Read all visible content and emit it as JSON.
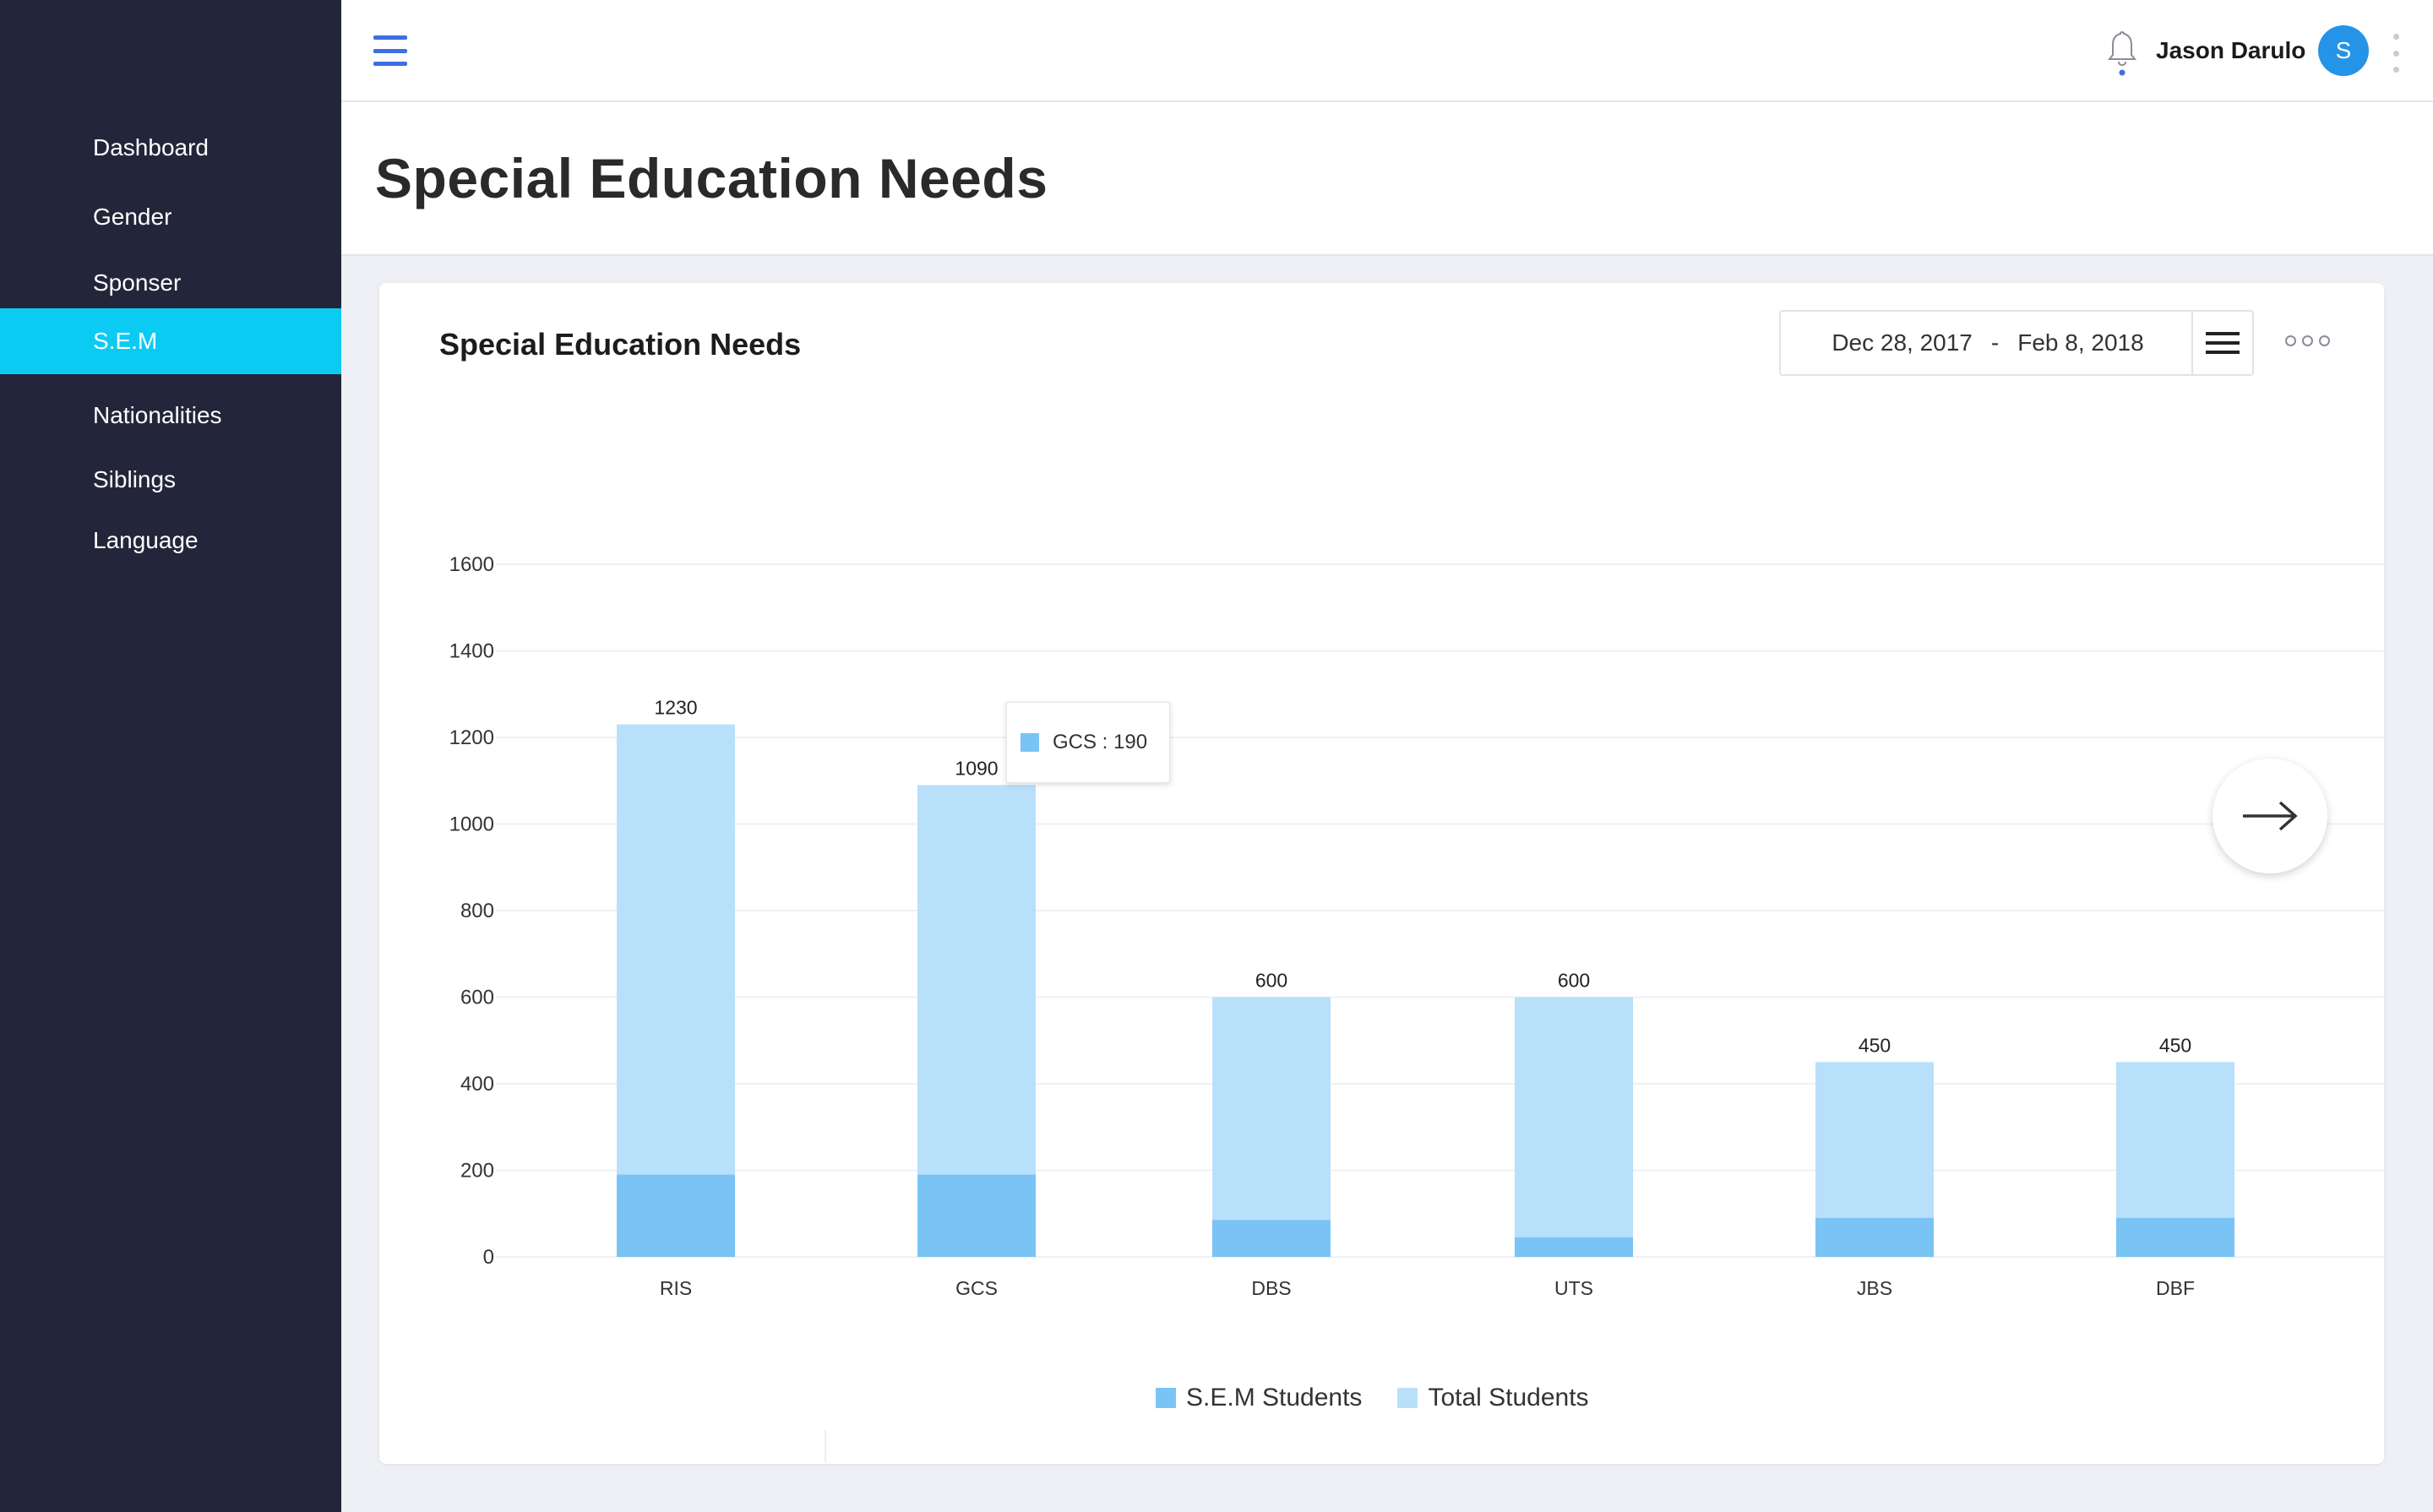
{
  "sidebar": {
    "items": [
      {
        "label": "Dashboard",
        "active": false
      },
      {
        "label": "Gender",
        "active": false
      },
      {
        "label": "Sponser",
        "active": false
      },
      {
        "label": "S.E.M",
        "active": true
      },
      {
        "label": "Nationalities",
        "active": false
      },
      {
        "label": "Siblings",
        "active": false
      },
      {
        "label": "Language",
        "active": false
      }
    ]
  },
  "header": {
    "user_name": "Jason Darulo",
    "avatar_initial": "S",
    "icons": [
      "menu-icon",
      "bell-icon",
      "kebab-icon"
    ]
  },
  "page": {
    "title": "Special Education Needs"
  },
  "card": {
    "title": "Special Education Needs",
    "date_from": "Dec 28, 2017",
    "date_sep": "-",
    "date_to": "Feb 8, 2018",
    "tooltip": "GCS : 190"
  },
  "colors": {
    "sidebar_bg": "#23253a",
    "active_item": "#0ccbf3",
    "sem_students": "#79c4f5",
    "total_students": "#b8e0fb",
    "accent": "#3d6fe0",
    "avatar": "#2593e8"
  },
  "chart_data": {
    "type": "bar",
    "stacked": true,
    "categories": [
      "RIS",
      "GCS",
      "DBS",
      "UTS",
      "JBS",
      "DBF"
    ],
    "series": [
      {
        "name": "S.E.M Students",
        "values": [
          190,
          190,
          85,
          45,
          90,
          90
        ]
      },
      {
        "name": "Total Students",
        "values": [
          1230,
          1090,
          600,
          600,
          450,
          450
        ]
      }
    ],
    "data_labels": [
      "1230",
      "1090",
      "600",
      "600",
      "450",
      "450"
    ],
    "yticks": [
      "0",
      "200",
      "400",
      "600",
      "800",
      "1000",
      "1200",
      "1400",
      "1600"
    ],
    "ylim": [
      0,
      1600
    ],
    "grid": true,
    "legend": "bottom"
  }
}
